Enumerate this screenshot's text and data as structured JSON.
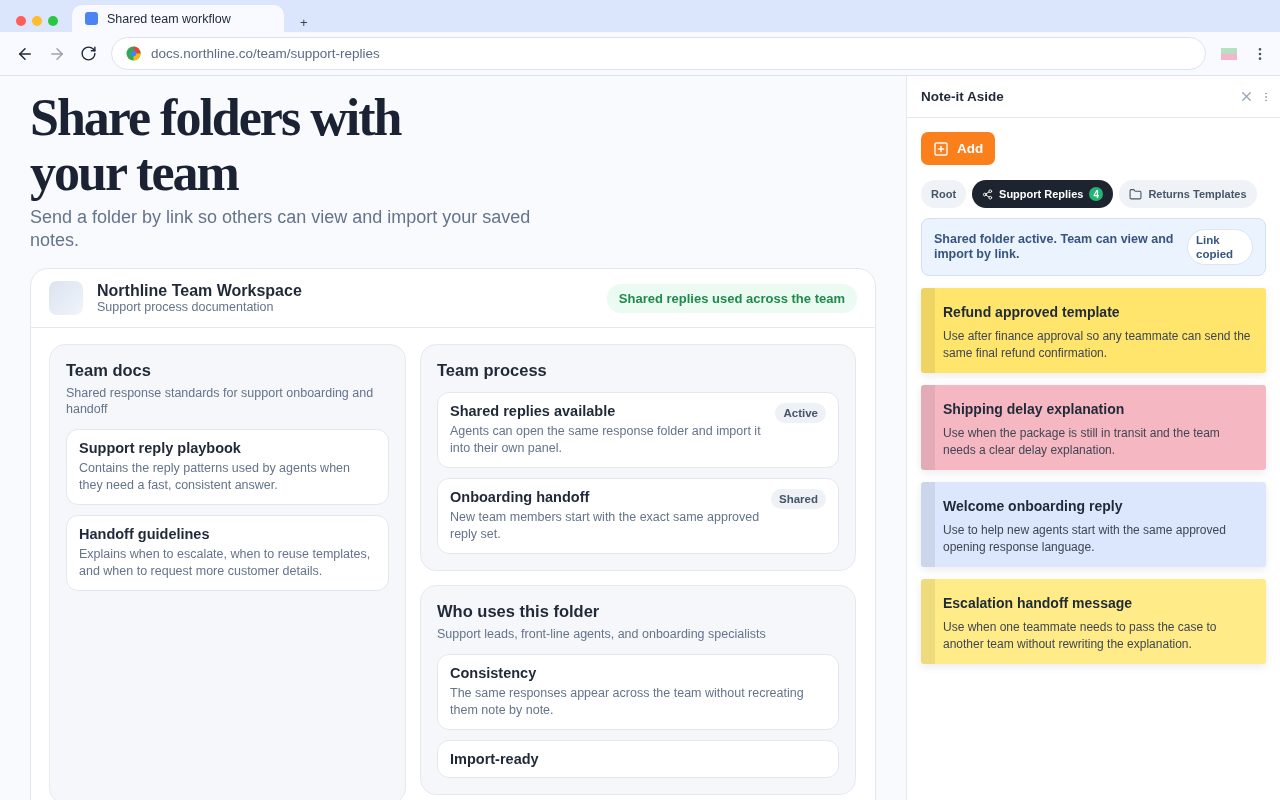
{
  "browser": {
    "tab_title": "Shared team workflow",
    "new_tab": "+",
    "url": "docs.northline.co/team/support-replies"
  },
  "page": {
    "title": "Share folders with your team",
    "subtitle": "Send a folder by link so others can view and import your saved notes.",
    "workspace": {
      "name": "Northline Team Workspace",
      "description": "Support process documentation",
      "badge": "Shared replies used across the team",
      "left_sections": [
        {
          "title": "Team docs",
          "description": "Shared response standards for support onboarding and handoff",
          "items": [
            {
              "title": "Support reply playbook",
              "text": "Contains the reply patterns used by agents when they need a fast, consistent answer."
            },
            {
              "title": "Handoff guidelines",
              "text": "Explains when to escalate, when to reuse templates, and when to request more customer details."
            }
          ]
        }
      ],
      "right_sections": [
        {
          "title": "Team process",
          "items": [
            {
              "title": "Shared replies available",
              "text": "Agents can open the same response folder and import it into their own panel.",
              "tag": "Active"
            },
            {
              "title": "Onboarding handoff",
              "text": "New team members start with the exact same approved reply set.",
              "tag": "Shared"
            }
          ]
        },
        {
          "title": "Who uses this folder",
          "description": "Support leads, front-line agents, and onboarding specialists",
          "items": [
            {
              "title": "Consistency",
              "text": "The same responses appear across the team without recreating them note by note."
            },
            {
              "title": "Import-ready"
            }
          ]
        }
      ]
    }
  },
  "panel": {
    "title": "Note-it Aside",
    "add_button": "Add",
    "folders": [
      {
        "label": "Root",
        "selected": false,
        "kind": "plain"
      },
      {
        "label": "Support Replies",
        "selected": true,
        "kind": "shared",
        "count": "4"
      },
      {
        "label": "Returns Templates",
        "selected": false,
        "kind": "folder"
      }
    ],
    "banner": {
      "text": "Shared folder active. Team can view and import by link.",
      "button": "Link copied"
    },
    "notes": [
      {
        "title": "Refund approved template",
        "text": "Use after finance approval so any teammate can send the same final refund confirmation.",
        "color": "#ffe56b"
      },
      {
        "title": "Shipping delay explanation",
        "text": "Use when the package is still in transit and the team needs a clear delay explanation.",
        "color": "#f5b8c3"
      },
      {
        "title": "Welcome onboarding reply",
        "text": "Use to help new agents start with the same approved opening response language.",
        "color": "#dce7fd"
      },
      {
        "title": "Escalation handoff message",
        "text": "Use when one teammate needs to pass the case to another team without rewriting the explanation.",
        "color": "#ffec88"
      }
    ]
  }
}
